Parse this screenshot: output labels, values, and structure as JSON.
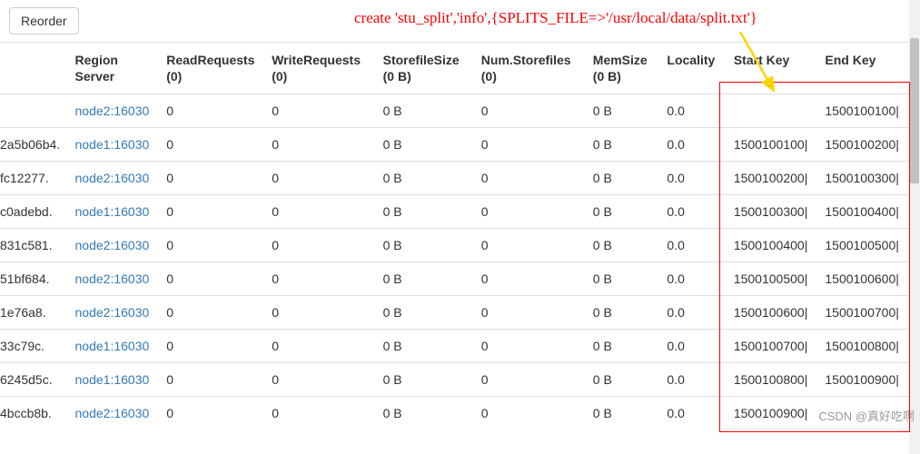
{
  "toolbar": {
    "reorder_label": "Reorder"
  },
  "annotation": {
    "text": "create 'stu_split','info',{SPLITS_FILE=>'/usr/local/data/split.txt'}"
  },
  "headers": {
    "name": "",
    "region_server": "Region Server",
    "read_requests": "ReadRequests (0)",
    "write_requests": "WriteRequests (0)",
    "storefile_size": "StorefileSize (0 B)",
    "num_storefiles": "Num.Storefiles (0)",
    "mem_size": "MemSize (0 B)",
    "locality": "Locality",
    "start_key": "Start Key",
    "end_key": "End Key"
  },
  "rows": [
    {
      "name": "",
      "server": "node2:16030",
      "rr": "0",
      "wr": "0",
      "sf": "0 B",
      "ns": "0",
      "ms": "0 B",
      "loc": "0.0",
      "sk": "",
      "ek": "1500100100|"
    },
    {
      "name": "2a5b06b4.",
      "server": "node1:16030",
      "rr": "0",
      "wr": "0",
      "sf": "0 B",
      "ns": "0",
      "ms": "0 B",
      "loc": "0.0",
      "sk": "1500100100|",
      "ek": "1500100200|"
    },
    {
      "name": "fc12277.",
      "server": "node2:16030",
      "rr": "0",
      "wr": "0",
      "sf": "0 B",
      "ns": "0",
      "ms": "0 B",
      "loc": "0.0",
      "sk": "1500100200|",
      "ek": "1500100300|"
    },
    {
      "name": "c0adebd.",
      "server": "node1:16030",
      "rr": "0",
      "wr": "0",
      "sf": "0 B",
      "ns": "0",
      "ms": "0 B",
      "loc": "0.0",
      "sk": "1500100300|",
      "ek": "1500100400|"
    },
    {
      "name": "831c581.",
      "server": "node2:16030",
      "rr": "0",
      "wr": "0",
      "sf": "0 B",
      "ns": "0",
      "ms": "0 B",
      "loc": "0.0",
      "sk": "1500100400|",
      "ek": "1500100500|"
    },
    {
      "name": "51bf684.",
      "server": "node2:16030",
      "rr": "0",
      "wr": "0",
      "sf": "0 B",
      "ns": "0",
      "ms": "0 B",
      "loc": "0.0",
      "sk": "1500100500|",
      "ek": "1500100600|"
    },
    {
      "name": "1e76a8.",
      "server": "node2:16030",
      "rr": "0",
      "wr": "0",
      "sf": "0 B",
      "ns": "0",
      "ms": "0 B",
      "loc": "0.0",
      "sk": "1500100600|",
      "ek": "1500100700|"
    },
    {
      "name": "33c79c.",
      "server": "node1:16030",
      "rr": "0",
      "wr": "0",
      "sf": "0 B",
      "ns": "0",
      "ms": "0 B",
      "loc": "0.0",
      "sk": "1500100700|",
      "ek": "1500100800|"
    },
    {
      "name": "6245d5c.",
      "server": "node1:16030",
      "rr": "0",
      "wr": "0",
      "sf": "0 B",
      "ns": "0",
      "ms": "0 B",
      "loc": "0.0",
      "sk": "1500100800|",
      "ek": "1500100900|"
    },
    {
      "name": "4bccb8b.",
      "server": "node2:16030",
      "rr": "0",
      "wr": "0",
      "sf": "0 B",
      "ns": "0",
      "ms": "0 B",
      "loc": "0.0",
      "sk": "1500100900|",
      "ek": ""
    }
  ],
  "watermark": "CSDN @真好吃啊"
}
